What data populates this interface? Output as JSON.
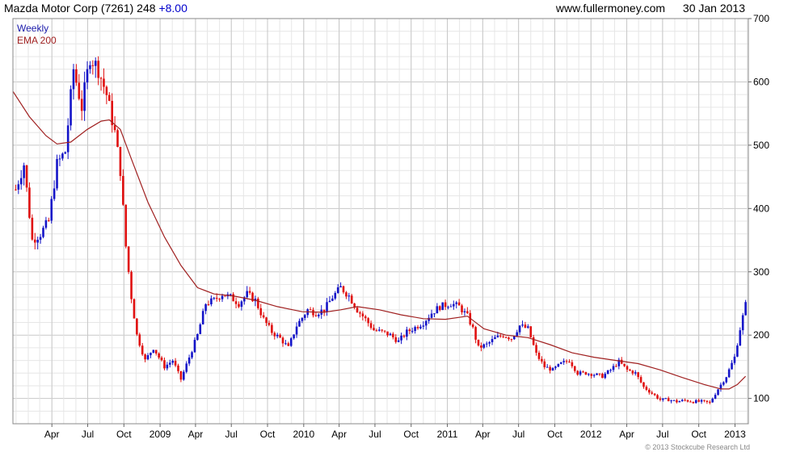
{
  "header": {
    "title": "Mazda Motor Corp (7261) 248",
    "change": "+8.00",
    "website": "www.fullermoney.com",
    "date": "30 Jan 2013"
  },
  "copyright": "© 2013 Stockcube Research Ltd",
  "chart_data": {
    "type": "candlestick",
    "title": "Mazda Motor Corp (7261) 248 +8.00",
    "interval": "Weekly",
    "legend": [
      {
        "name": "Weekly",
        "color": "#1a1aaa"
      },
      {
        "name": "EMA 200",
        "color": "#a02020"
      }
    ],
    "legend_position": "top-left",
    "y_axis_side": "right",
    "ylim": [
      60,
      700
    ],
    "yticks": [
      100,
      200,
      300,
      400,
      500,
      600,
      700
    ],
    "xlim": [
      "2007-12-24",
      "2013-02-04"
    ],
    "x_ticks": [
      {
        "label": "Apr",
        "date": "2008-04-01"
      },
      {
        "label": "Jul",
        "date": "2008-07-01"
      },
      {
        "label": "Oct",
        "date": "2008-10-01"
      },
      {
        "label": "2009",
        "date": "2009-01-01"
      },
      {
        "label": "Apr",
        "date": "2009-04-01"
      },
      {
        "label": "Jul",
        "date": "2009-07-01"
      },
      {
        "label": "Oct",
        "date": "2009-10-01"
      },
      {
        "label": "2010",
        "date": "2010-01-01"
      },
      {
        "label": "Apr",
        "date": "2010-04-01"
      },
      {
        "label": "Jul",
        "date": "2010-07-01"
      },
      {
        "label": "Oct",
        "date": "2010-10-01"
      },
      {
        "label": "2011",
        "date": "2011-01-01"
      },
      {
        "label": "Apr",
        "date": "2011-04-01"
      },
      {
        "label": "Jul",
        "date": "2011-07-01"
      },
      {
        "label": "Oct",
        "date": "2011-10-01"
      },
      {
        "label": "2012",
        "date": "2012-01-01"
      },
      {
        "label": "Apr",
        "date": "2012-04-01"
      },
      {
        "label": "Jul",
        "date": "2012-07-01"
      },
      {
        "label": "Oct",
        "date": "2012-10-01"
      },
      {
        "label": "2013",
        "date": "2013-01-01"
      }
    ],
    "grid": true,
    "up_color": "#1414c8",
    "down_color": "#e01010",
    "ema_color": "#a02020",
    "price_path": [
      [
        "2007-12-31",
        430
      ],
      [
        "2008-01-21",
        470
      ],
      [
        "2008-02-11",
        350
      ],
      [
        "2008-03-03",
        360
      ],
      [
        "2008-03-24",
        380
      ],
      [
        "2008-04-14",
        470
      ],
      [
        "2008-05-05",
        490
      ],
      [
        "2008-05-26",
        620
      ],
      [
        "2008-06-16",
        560
      ],
      [
        "2008-07-07",
        640
      ],
      [
        "2008-07-28",
        620
      ],
      [
        "2008-08-18",
        580
      ],
      [
        "2008-09-08",
        520
      ],
      [
        "2008-09-22",
        460
      ],
      [
        "2008-10-06",
        340
      ],
      [
        "2008-10-20",
        260
      ],
      [
        "2008-11-03",
        200
      ],
      [
        "2008-11-24",
        160
      ],
      [
        "2008-12-15",
        180
      ],
      [
        "2009-01-12",
        150
      ],
      [
        "2009-02-02",
        160
      ],
      [
        "2009-02-23",
        130
      ],
      [
        "2009-03-16",
        165
      ],
      [
        "2009-04-06",
        200
      ],
      [
        "2009-04-27",
        250
      ],
      [
        "2009-05-18",
        255
      ],
      [
        "2009-06-08",
        265
      ],
      [
        "2009-06-29",
        260
      ],
      [
        "2009-07-20",
        250
      ],
      [
        "2009-08-10",
        265
      ],
      [
        "2009-08-31",
        255
      ],
      [
        "2009-09-21",
        225
      ],
      [
        "2009-10-12",
        205
      ],
      [
        "2009-11-02",
        195
      ],
      [
        "2009-11-23",
        180
      ],
      [
        "2009-12-14",
        215
      ],
      [
        "2010-01-11",
        240
      ],
      [
        "2010-02-01",
        235
      ],
      [
        "2010-02-22",
        240
      ],
      [
        "2010-03-15",
        260
      ],
      [
        "2010-04-05",
        275
      ],
      [
        "2010-04-26",
        262
      ],
      [
        "2010-05-17",
        240
      ],
      [
        "2010-06-07",
        225
      ],
      [
        "2010-06-28",
        208
      ],
      [
        "2010-07-19",
        205
      ],
      [
        "2010-08-09",
        200
      ],
      [
        "2010-08-30",
        190
      ],
      [
        "2010-09-20",
        205
      ],
      [
        "2010-10-11",
        212
      ],
      [
        "2010-11-01",
        220
      ],
      [
        "2010-11-22",
        235
      ],
      [
        "2010-12-13",
        245
      ],
      [
        "2011-01-10",
        250
      ],
      [
        "2011-01-31",
        245
      ],
      [
        "2011-02-21",
        230
      ],
      [
        "2011-03-07",
        210
      ],
      [
        "2011-03-21",
        180
      ],
      [
        "2011-04-11",
        185
      ],
      [
        "2011-05-02",
        195
      ],
      [
        "2011-05-23",
        200
      ],
      [
        "2011-06-13",
        195
      ],
      [
        "2011-07-04",
        215
      ],
      [
        "2011-07-25",
        210
      ],
      [
        "2011-08-15",
        170
      ],
      [
        "2011-09-05",
        150
      ],
      [
        "2011-09-26",
        145
      ],
      [
        "2011-10-17",
        155
      ],
      [
        "2011-11-07",
        160
      ],
      [
        "2011-11-28",
        140
      ],
      [
        "2011-12-19",
        140
      ],
      [
        "2012-01-09",
        138
      ],
      [
        "2012-01-30",
        135
      ],
      [
        "2012-02-20",
        145
      ],
      [
        "2012-03-12",
        158
      ],
      [
        "2012-04-02",
        145
      ],
      [
        "2012-04-23",
        140
      ],
      [
        "2012-05-14",
        118
      ],
      [
        "2012-06-04",
        108
      ],
      [
        "2012-06-25",
        98
      ],
      [
        "2012-07-16",
        98
      ],
      [
        "2012-08-06",
        95
      ],
      [
        "2012-08-27",
        97
      ],
      [
        "2012-09-17",
        95
      ],
      [
        "2012-10-08",
        95
      ],
      [
        "2012-10-29",
        93
      ],
      [
        "2012-11-19",
        115
      ],
      [
        "2012-12-10",
        135
      ],
      [
        "2012-12-31",
        165
      ],
      [
        "2013-01-14",
        210
      ],
      [
        "2013-01-28",
        248
      ]
    ],
    "ema200": [
      [
        "2007-12-24",
        585
      ],
      [
        "2008-02-04",
        545
      ],
      [
        "2008-03-17",
        515
      ],
      [
        "2008-04-14",
        502
      ],
      [
        "2008-05-19",
        505
      ],
      [
        "2008-06-30",
        525
      ],
      [
        "2008-08-04",
        538
      ],
      [
        "2008-08-25",
        540
      ],
      [
        "2008-09-22",
        525
      ],
      [
        "2008-10-20",
        478
      ],
      [
        "2008-12-01",
        410
      ],
      [
        "2009-01-12",
        355
      ],
      [
        "2009-02-23",
        310
      ],
      [
        "2009-04-06",
        275
      ],
      [
        "2009-05-18",
        265
      ],
      [
        "2009-07-06",
        262
      ],
      [
        "2009-08-31",
        255
      ],
      [
        "2009-10-26",
        245
      ],
      [
        "2009-12-28",
        237
      ],
      [
        "2010-02-22",
        236
      ],
      [
        "2010-04-05",
        240
      ],
      [
        "2010-05-17",
        245
      ],
      [
        "2010-07-12",
        240
      ],
      [
        "2010-09-06",
        232
      ],
      [
        "2010-11-01",
        226
      ],
      [
        "2010-12-27",
        225
      ],
      [
        "2011-02-21",
        230
      ],
      [
        "2011-04-04",
        210
      ],
      [
        "2011-05-30",
        200
      ],
      [
        "2011-07-25",
        196
      ],
      [
        "2011-09-19",
        185
      ],
      [
        "2011-11-14",
        172
      ],
      [
        "2012-01-09",
        165
      ],
      [
        "2012-03-05",
        160
      ],
      [
        "2012-04-30",
        155
      ],
      [
        "2012-06-25",
        145
      ],
      [
        "2012-08-20",
        133
      ],
      [
        "2012-10-15",
        122
      ],
      [
        "2012-11-26",
        115
      ],
      [
        "2012-12-17",
        115
      ],
      [
        "2013-01-07",
        122
      ],
      [
        "2013-01-28",
        135
      ]
    ]
  }
}
